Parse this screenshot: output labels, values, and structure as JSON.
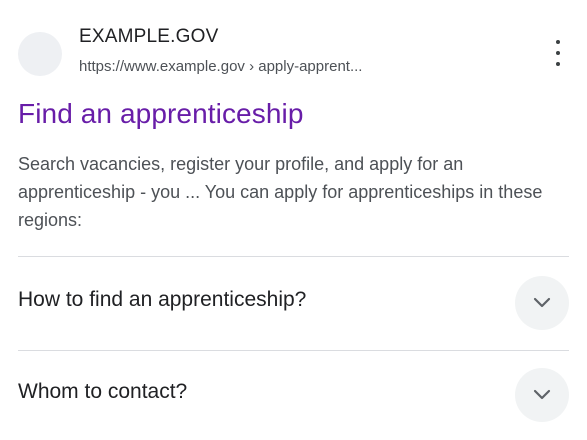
{
  "result": {
    "site_name": "EXAMPLE.GOV",
    "site_url": "https://www.example.gov › apply-apprent...",
    "title": "Find an apprenticeship",
    "snippet": "Search vacancies, register your profile, and apply for an apprenticeship - you ... You can apply for apprenticeships in these regions:",
    "faqs": [
      {
        "question": "How to find an apprenticeship?",
        "icon": "chevron-down-icon"
      },
      {
        "question": "Whom to contact?",
        "icon": "chevron-down-icon"
      }
    ],
    "menu_icon": "more-vert-icon"
  },
  "colors": {
    "title_visited": "#681da8",
    "body_text": "#4d5156",
    "heading_text": "#202124",
    "divider": "#dadce0",
    "chevron_button_bg": "#f1f3f4"
  }
}
